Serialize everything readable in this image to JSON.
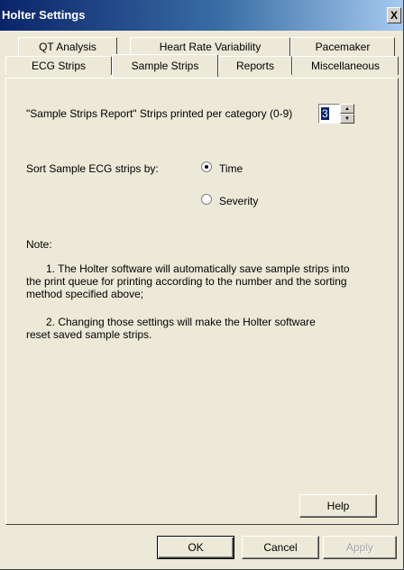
{
  "window": {
    "title": "Holter Settings",
    "close_glyph": "X"
  },
  "tabs": {
    "row1": [
      "QT Analysis",
      "Heart Rate Variability",
      "Pacemaker"
    ],
    "row2": [
      "ECG Strips",
      "Sample Strips",
      "Reports",
      "Miscellaneous"
    ],
    "active": "Sample Strips"
  },
  "panel": {
    "strips_label": "\"Sample Strips Report\" Strips printed per category (0-9)",
    "strips_value": "3",
    "sort_label": "Sort Sample ECG strips by:",
    "sort_options": [
      "Time",
      "Severity"
    ],
    "sort_selected": "Time",
    "note_label": "Note:",
    "note_1": "1. The Holter software will automatically save sample strips into the print queue for printing according to the number and the sorting method specified above;",
    "note_2": "2. Changing those settings will make the Holter software reset saved sample strips.",
    "help_label": "Help"
  },
  "footer": {
    "ok_label": "OK",
    "cancel_label": "Cancel",
    "apply_label": "Apply",
    "apply_enabled": false
  }
}
